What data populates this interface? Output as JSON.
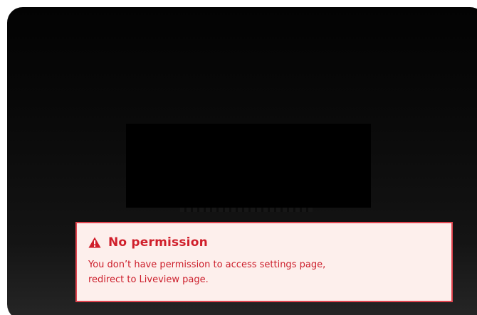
{
  "colors": {
    "alert_border": "#e0454f",
    "alert_background": "#fdefec",
    "alert_text": "#cc1d2a",
    "frame_background": "#0a0a0a"
  },
  "alert": {
    "icon": "warning-triangle-icon",
    "title": "No permission",
    "message_line1": "You don’t have permission to access settings page,",
    "message_line2": "redirect to Liveview page."
  }
}
